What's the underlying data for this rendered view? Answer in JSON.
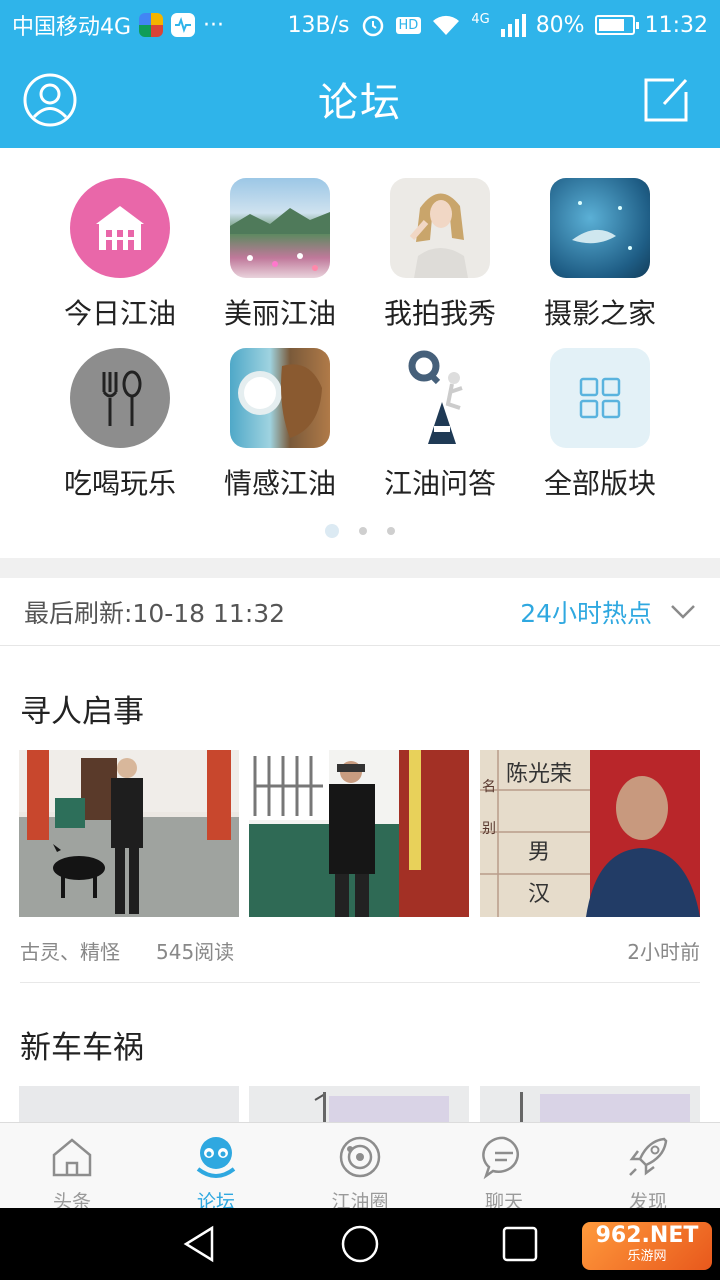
{
  "status_bar": {
    "carrier": "中国移动4G",
    "speed": "13B/s",
    "hd": "HD",
    "network": "4G",
    "battery": "80%",
    "battery_level": 0.8,
    "time": "11:32"
  },
  "header": {
    "title": "论坛",
    "left_icon": "profile-icon",
    "right_icon": "compose-icon"
  },
  "categories": [
    {
      "label": "今日江油",
      "icon": "house-icon"
    },
    {
      "label": "美丽江油",
      "icon": "landscape-image"
    },
    {
      "label": "我拍我秀",
      "icon": "portrait-image"
    },
    {
      "label": "摄影之家",
      "icon": "water-image"
    },
    {
      "label": "吃喝玩乐",
      "icon": "cutlery-icon"
    },
    {
      "label": "情感江油",
      "icon": "kiss-image"
    },
    {
      "label": "江油问答",
      "icon": "qa-image"
    },
    {
      "label": "全部版块",
      "icon": "grid-icon"
    }
  ],
  "pager": {
    "pages": 3,
    "active": 0
  },
  "refresh": {
    "last_refresh": "最后刷新:10-18 11:32",
    "filter": "24小时热点"
  },
  "posts": [
    {
      "title": "寻人启事",
      "author": "古灵、精怪",
      "reads": "545阅读",
      "time": "2小时前",
      "photo_text": [
        "名",
        "陈光荣",
        "别",
        "男",
        "汉"
      ]
    },
    {
      "title": "新车车祸"
    }
  ],
  "bottom_nav": [
    {
      "label": "头条",
      "icon": "home-icon",
      "active": false
    },
    {
      "label": "论坛",
      "icon": "forum-mascot-icon",
      "active": true
    },
    {
      "label": "江油圈",
      "icon": "circle-icon",
      "active": false
    },
    {
      "label": "聊天",
      "icon": "chat-icon",
      "active": false
    },
    {
      "label": "发现",
      "icon": "rocket-icon",
      "active": false
    }
  ],
  "watermark": {
    "text": "962.NET",
    "sub": "乐游网"
  },
  "colors": {
    "brand": "#2fb4ea",
    "accent_text": "#2fa8e0",
    "pink": "#e967a9"
  }
}
